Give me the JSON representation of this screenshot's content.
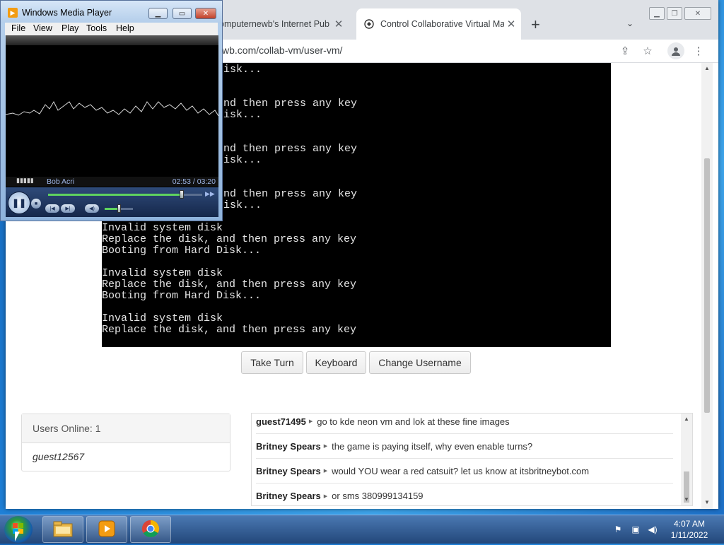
{
  "browser": {
    "tabs": [
      {
        "label": "omputernewb's Internet Pub H",
        "active": false
      },
      {
        "label": "Control Collaborative Virtual Ma",
        "active": true
      }
    ],
    "url": "wb.com/collab-vm/user-vm/",
    "new_tab_symbol": "+"
  },
  "vm": {
    "lines": [
      "isk...",
      "",
      "",
      "nd then press any key",
      "isk...",
      "",
      "",
      "nd then press any key",
      "isk...",
      "",
      "",
      "nd then press any key",
      "isk...",
      "",
      "Invalid system disk",
      "Replace the disk, and then press any key",
      "Booting from Hard Disk...",
      "",
      "Invalid system disk",
      "Replace the disk, and then press any key",
      "Booting from Hard Disk...",
      "",
      "Invalid system disk",
      "Replace the disk, and then press any key"
    ],
    "buttons": {
      "take_turn": "Take Turn",
      "keyboard": "Keyboard",
      "change_username": "Change Username"
    }
  },
  "users_panel": {
    "header": "Users Online: 1",
    "users": [
      "guest12567"
    ]
  },
  "chat": {
    "messages": [
      {
        "user": "guest71495",
        "text": "go to kde neon vm and lok at these fine images"
      },
      {
        "user": "Britney Spears",
        "text": "the game is paying itself, why even enable turns?"
      },
      {
        "user": "Britney Spears",
        "text": "would YOU wear a red catsuit? let us know at itsbritneybot.com"
      },
      {
        "user": "Britney Spears",
        "text": "or sms 380999134159"
      }
    ]
  },
  "wmp": {
    "title": "Windows Media Player",
    "menu": [
      "File",
      "View",
      "Play",
      "Tools",
      "Help"
    ],
    "artist": "Bob Acri",
    "time": "02:53 / 03:20",
    "progress": 0.865,
    "volume": 0.5
  },
  "taskbar": {
    "time": "4:07 AM",
    "date": "1/11/2022",
    "pinned": [
      "explorer-icon",
      "media-player-icon",
      "chrome-icon"
    ]
  }
}
